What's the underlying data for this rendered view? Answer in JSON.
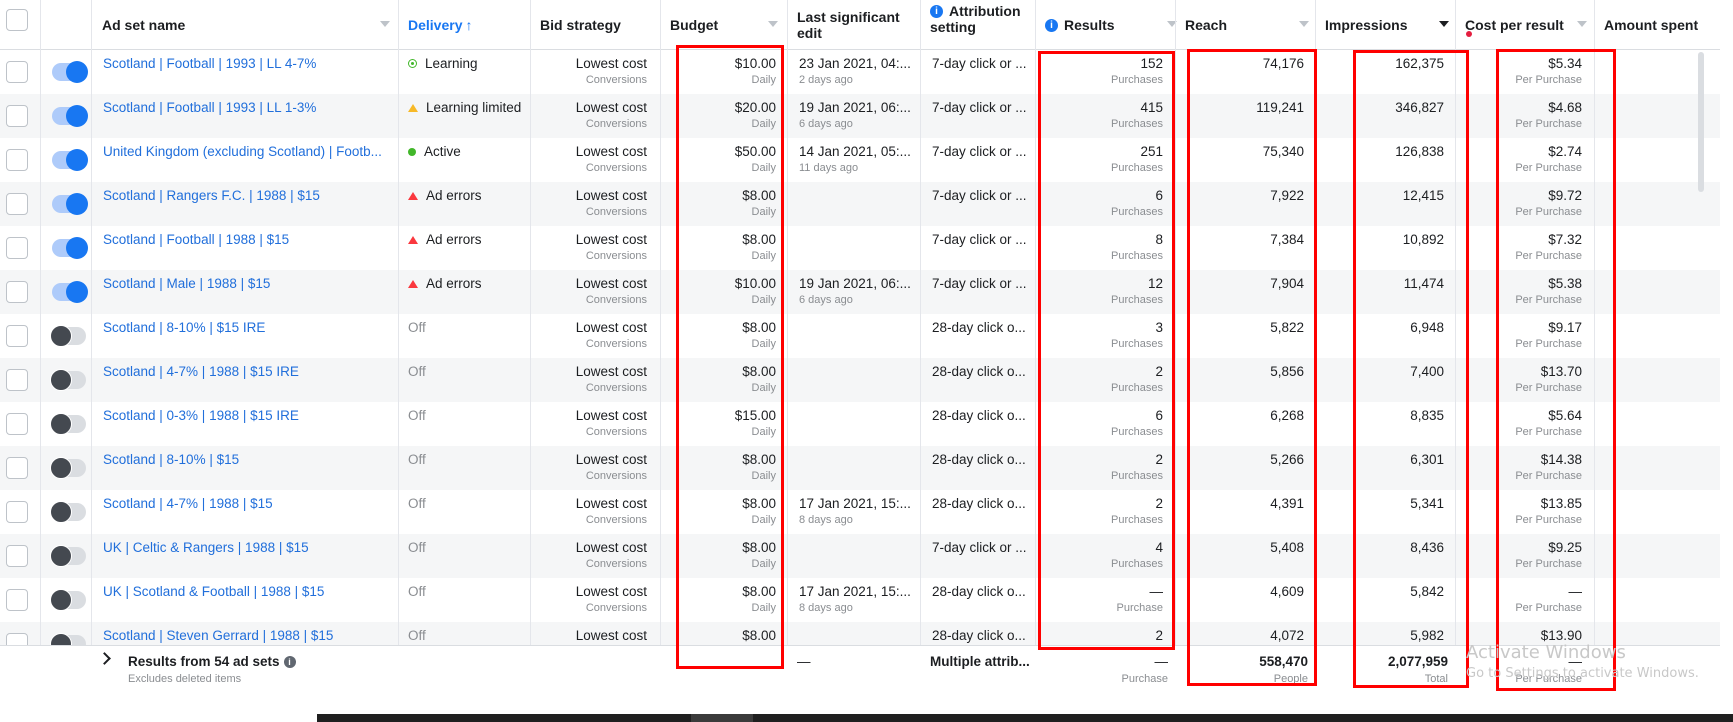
{
  "header": {
    "ad_set_name": "Ad set name",
    "delivery": "Delivery",
    "delivery_sort": "↑",
    "bid_strategy": "Bid strategy",
    "budget": "Budget",
    "last_edit_1": "Last significant",
    "last_edit_2": "edit",
    "attribution_1": "Attribution",
    "attribution_2": "setting",
    "results": "Results",
    "reach": "Reach",
    "impressions": "Impressions",
    "cost_per_result": "Cost per result",
    "amount_spent": "Amount spent"
  },
  "rows": [
    {
      "toggle": "on",
      "name": "Scotland | Football | 1993 | LL 4-7%",
      "status": "Learning",
      "status_kind": "learning",
      "bid": "Lowest cost",
      "bid_sub": "Conversions",
      "budget": "$10.00",
      "budget_sub": "Daily",
      "edit": "23 Jan 2021, 04:...",
      "edit_sub": "2 days ago",
      "attribution": "7-day click or ...",
      "results": "152",
      "results_sub": "Purchases",
      "reach": "74,176",
      "impressions": "162,375",
      "cpr": "$5.34",
      "cpr_sub": "Per Purchase"
    },
    {
      "toggle": "on",
      "name": "Scotland | Football | 1993 | LL 1-3%",
      "status": "Learning limited",
      "status_kind": "limited",
      "bid": "Lowest cost",
      "bid_sub": "Conversions",
      "budget": "$20.00",
      "budget_sub": "Daily",
      "edit": "19 Jan 2021, 06:...",
      "edit_sub": "6 days ago",
      "attribution": "7-day click or ...",
      "results": "415",
      "results_sub": "Purchases",
      "reach": "119,241",
      "impressions": "346,827",
      "cpr": "$4.68",
      "cpr_sub": "Per Purchase"
    },
    {
      "toggle": "on",
      "name": "United Kingdom (excluding Scotland) | Footb...",
      "status": "Active",
      "status_kind": "active",
      "bid": "Lowest cost",
      "bid_sub": "Conversions",
      "budget": "$50.00",
      "budget_sub": "Daily",
      "edit": "14 Jan 2021, 05:...",
      "edit_sub": "11 days ago",
      "attribution": "7-day click or ...",
      "results": "251",
      "results_sub": "Purchases",
      "reach": "75,340",
      "impressions": "126,838",
      "cpr": "$2.74",
      "cpr_sub": "Per Purchase"
    },
    {
      "toggle": "on",
      "name": "Scotland | Rangers F.C. | 1988 | $15",
      "status": "Ad errors",
      "status_kind": "error",
      "bid": "Lowest cost",
      "bid_sub": "Conversions",
      "budget": "$8.00",
      "budget_sub": "Daily",
      "edit": "",
      "edit_sub": "",
      "attribution": "7-day click or ...",
      "results": "6",
      "results_sub": "Purchases",
      "reach": "7,922",
      "impressions": "12,415",
      "cpr": "$9.72",
      "cpr_sub": "Per Purchase"
    },
    {
      "toggle": "on",
      "name": "Scotland | Football | 1988 | $15",
      "status": "Ad errors",
      "status_kind": "error",
      "bid": "Lowest cost",
      "bid_sub": "Conversions",
      "budget": "$8.00",
      "budget_sub": "Daily",
      "edit": "",
      "edit_sub": "",
      "attribution": "7-day click or ...",
      "results": "8",
      "results_sub": "Purchases",
      "reach": "7,384",
      "impressions": "10,892",
      "cpr": "$7.32",
      "cpr_sub": "Per Purchase"
    },
    {
      "toggle": "on",
      "name": "Scotland | Male | 1988 | $15",
      "status": "Ad errors",
      "status_kind": "error",
      "bid": "Lowest cost",
      "bid_sub": "Conversions",
      "budget": "$10.00",
      "budget_sub": "Daily",
      "edit": "19 Jan 2021, 06:...",
      "edit_sub": "6 days ago",
      "attribution": "7-day click or ...",
      "results": "12",
      "results_sub": "Purchases",
      "reach": "7,904",
      "impressions": "11,474",
      "cpr": "$5.38",
      "cpr_sub": "Per Purchase"
    },
    {
      "toggle": "off",
      "name": "Scotland | 8-10% | $15 IRE",
      "status": "Off",
      "status_kind": "off",
      "bid": "Lowest cost",
      "bid_sub": "Conversions",
      "budget": "$8.00",
      "budget_sub": "Daily",
      "edit": "",
      "edit_sub": "",
      "attribution": "28-day click o...",
      "results": "3",
      "results_sub": "Purchases",
      "reach": "5,822",
      "impressions": "6,948",
      "cpr": "$9.17",
      "cpr_sub": "Per Purchase"
    },
    {
      "toggle": "off",
      "name": "Scotland | 4-7% | 1988 | $15 IRE",
      "status": "Off",
      "status_kind": "off",
      "bid": "Lowest cost",
      "bid_sub": "Conversions",
      "budget": "$8.00",
      "budget_sub": "Daily",
      "edit": "",
      "edit_sub": "",
      "attribution": "28-day click o...",
      "results": "2",
      "results_sub": "Purchases",
      "reach": "5,856",
      "impressions": "7,400",
      "cpr": "$13.70",
      "cpr_sub": "Per Purchase"
    },
    {
      "toggle": "off",
      "name": "Scotland | 0-3% | 1988 | $15 IRE",
      "status": "Off",
      "status_kind": "off",
      "bid": "Lowest cost",
      "bid_sub": "Conversions",
      "budget": "$15.00",
      "budget_sub": "Daily",
      "edit": "",
      "edit_sub": "",
      "attribution": "28-day click o...",
      "results": "6",
      "results_sub": "Purchases",
      "reach": "6,268",
      "impressions": "8,835",
      "cpr": "$5.64",
      "cpr_sub": "Per Purchase"
    },
    {
      "toggle": "off",
      "name": "Scotland | 8-10% | $15",
      "status": "Off",
      "status_kind": "off",
      "bid": "Lowest cost",
      "bid_sub": "Conversions",
      "budget": "$8.00",
      "budget_sub": "Daily",
      "edit": "",
      "edit_sub": "",
      "attribution": "28-day click o...",
      "results": "2",
      "results_sub": "Purchases",
      "reach": "5,266",
      "impressions": "6,301",
      "cpr": "$14.38",
      "cpr_sub": "Per Purchase"
    },
    {
      "toggle": "off",
      "name": "Scotland | 4-7% | 1988 | $15",
      "status": "Off",
      "status_kind": "off",
      "bid": "Lowest cost",
      "bid_sub": "Conversions",
      "budget": "$8.00",
      "budget_sub": "Daily",
      "edit": "17 Jan 2021, 15:...",
      "edit_sub": "8 days ago",
      "attribution": "28-day click o...",
      "results": "2",
      "results_sub": "Purchases",
      "reach": "4,391",
      "impressions": "5,341",
      "cpr": "$13.85",
      "cpr_sub": "Per Purchase"
    },
    {
      "toggle": "off",
      "name": "UK | Celtic & Rangers | 1988 | $15",
      "status": "Off",
      "status_kind": "off",
      "bid": "Lowest cost",
      "bid_sub": "Conversions",
      "budget": "$8.00",
      "budget_sub": "Daily",
      "edit": "",
      "edit_sub": "",
      "attribution": "7-day click or ...",
      "results": "4",
      "results_sub": "Purchases",
      "reach": "5,408",
      "impressions": "8,436",
      "cpr": "$9.25",
      "cpr_sub": "Per Purchase"
    },
    {
      "toggle": "off",
      "name": "UK | Scotland & Football | 1988 | $15",
      "status": "Off",
      "status_kind": "off",
      "bid": "Lowest cost",
      "bid_sub": "Conversions",
      "budget": "$8.00",
      "budget_sub": "Daily",
      "edit": "17 Jan 2021, 15:...",
      "edit_sub": "8 days ago",
      "attribution": "28-day click o...",
      "results": "—",
      "results_sub": "Purchase",
      "reach": "4,609",
      "impressions": "5,842",
      "cpr": "—",
      "cpr_sub": "Per Purchase"
    },
    {
      "toggle": "off",
      "name": "Scotland | Steven Gerrard | 1988 | $15",
      "status": "Off",
      "status_kind": "off",
      "bid": "Lowest cost",
      "bid_sub": "",
      "budget": "$8.00",
      "budget_sub": "",
      "edit": "",
      "edit_sub": "",
      "attribution": "28-day click o...",
      "results": "2",
      "results_sub": "",
      "reach": "4,072",
      "impressions": "5,982",
      "cpr": "$13.90",
      "cpr_sub": ""
    }
  ],
  "footer": {
    "results_label": "Results from 54 ad sets",
    "excludes": "Excludes deleted items",
    "last_edit": "—",
    "attribution": "Multiple attrib...",
    "results": "—",
    "results_sub": "Purchase",
    "reach": "558,470",
    "reach_sub": "People",
    "impressions": "2,077,959",
    "impressions_sub": "Total",
    "cpr": "—",
    "cpr_sub": "Per Purchase"
  },
  "watermark": {
    "title": "Activate Windows",
    "subtitle": "Go to Settings to activate Windows."
  },
  "colors": {
    "link_blue": "#216fdb",
    "accent": "#1877f2",
    "highlight_red": "#ff0000",
    "error_red": "#fa383e",
    "active_green": "#42b72a",
    "warning_orange": "#f7b928"
  }
}
